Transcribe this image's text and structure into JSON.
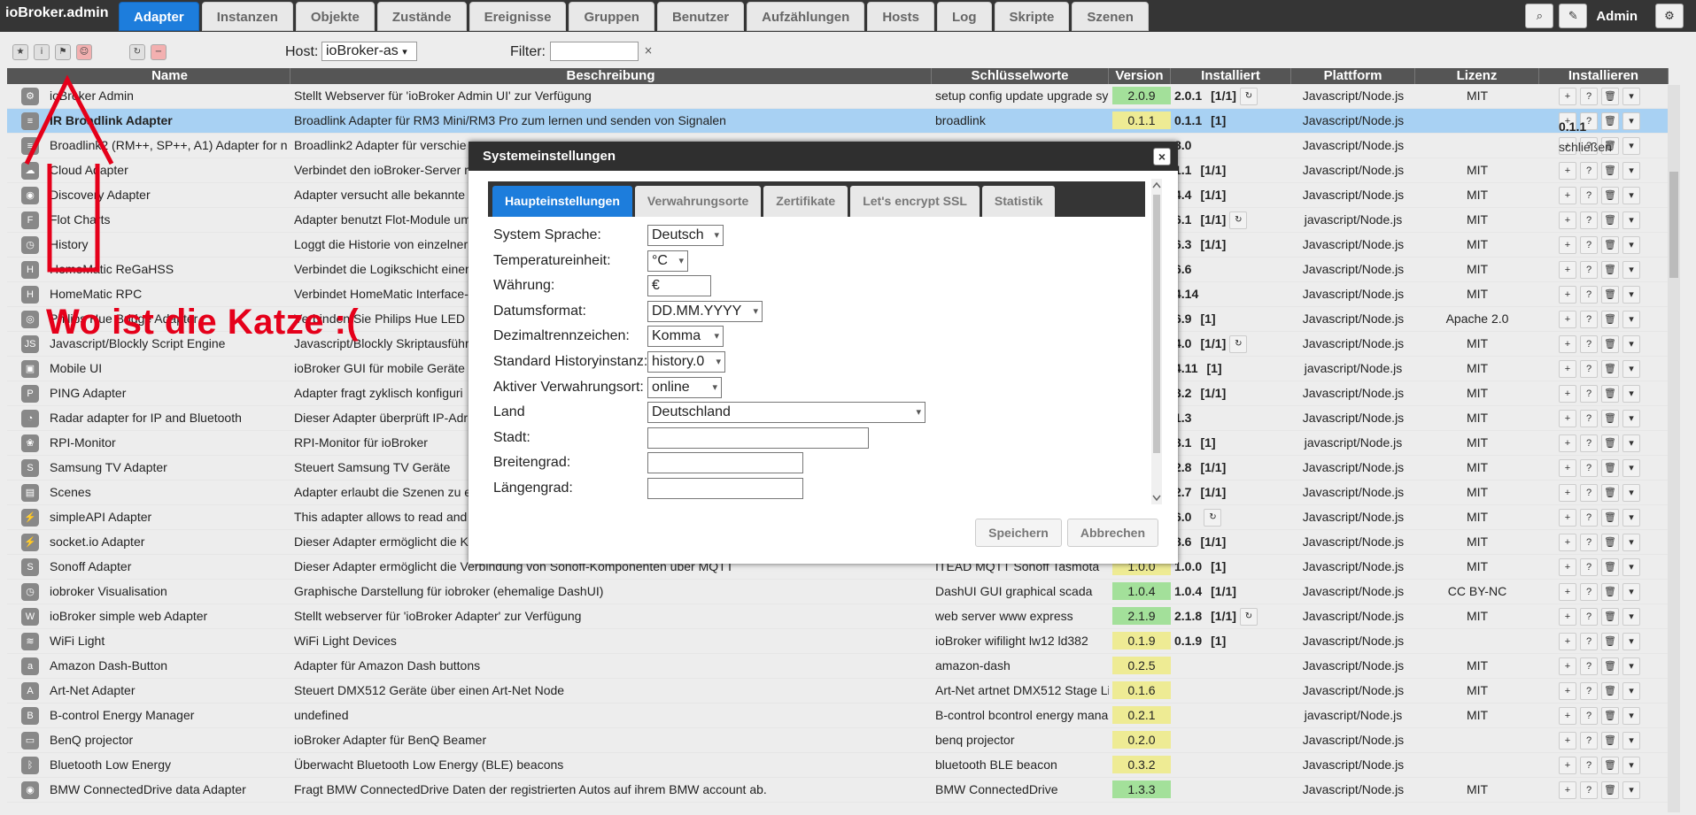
{
  "app": {
    "title": "ioBroker.admin",
    "user": "Admin"
  },
  "tabs": [
    "Adapter",
    "Instanzen",
    "Objekte",
    "Zustände",
    "Ereignisse",
    "Gruppen",
    "Benutzer",
    "Aufzählungen",
    "Hosts",
    "Log",
    "Skripte",
    "Szenen"
  ],
  "toolbar": {
    "host_label": "Host:",
    "host_value": "ioBroker-as",
    "filter_label": "Filter:",
    "filter_value": "",
    "filter_clear": "×"
  },
  "columns": [
    "Name",
    "Beschreibung",
    "Schlüsselworte",
    "Version",
    "Installiert",
    "Plattform",
    "Lizenz",
    "Installieren"
  ],
  "rows": [
    {
      "name": "ioBroker Admin",
      "desc": "Stellt Webserver für 'ioBroker Admin UI' zur Verfügung",
      "keys": "setup config update upgrade sy",
      "ver": "2.0.9",
      "vc": "green",
      "inst": "2.0.1",
      "cnt": "[1/1]",
      "plat": "Javascript/Node.js",
      "lic": "MIT",
      "icon": "⚙"
    },
    {
      "name": "IR Broadlink Adapter",
      "desc": "Broadlink Adapter für RM3 Mini/RM3 Pro zum lernen und senden von Signalen",
      "keys": "broadlink",
      "ver": "0.1.1",
      "vc": "yellow",
      "inst": "0.1.1",
      "cnt": "[1]",
      "plat": "Javascript/Node.js",
      "lic": "",
      "icon": "≡",
      "sel": true
    },
    {
      "name": "Broadlink2 (RM++, SP++, A1) Adapter for n",
      "desc": "Broadlink2 Adapter für verschie",
      "keys": "",
      "ver": "",
      "vc": "",
      "inst": "8.0",
      "cnt": "",
      "plat": "Javascript/Node.js",
      "lic": "",
      "icon": "≡"
    },
    {
      "name": "Cloud Adapter",
      "desc": "Verbindet den ioBroker-Server m",
      "keys": "",
      "ver": "",
      "vc": "",
      "inst": "1.1",
      "cnt": "[1/1]",
      "plat": "Javascript/Node.js",
      "lic": "MIT",
      "icon": "☁"
    },
    {
      "name": "Discovery Adapter",
      "desc": "Adapter versucht alle bekannte",
      "keys": "",
      "ver": "",
      "vc": "",
      "inst": "4.4",
      "cnt": "[1/1]",
      "plat": "Javascript/Node.js",
      "lic": "MIT",
      "icon": "◉"
    },
    {
      "name": "Flot Charts",
      "desc": "Adapter benutzt Flot-Module um",
      "keys": "",
      "ver": "",
      "vc": "",
      "inst": "6.1",
      "cnt": "[1/1]",
      "plat": "javascript/Node.js",
      "lic": "MIT",
      "icon": "F"
    },
    {
      "name": "History",
      "desc": "Loggt die Historie von einzelner",
      "keys": "",
      "ver": "",
      "vc": "",
      "inst": "6.3",
      "cnt": "[1/1]",
      "plat": "Javascript/Node.js",
      "lic": "MIT",
      "icon": "◷"
    },
    {
      "name": "HomeMatic ReGaHSS",
      "desc": "Verbindet die Logikschicht einer",
      "keys": "",
      "ver": "",
      "vc": "",
      "inst": "6.6",
      "cnt": "",
      "plat": "Javascript/Node.js",
      "lic": "MIT",
      "icon": "H"
    },
    {
      "name": "HomeMatic RPC",
      "desc": "Verbindet HomeMatic Interface-",
      "keys": "",
      "ver": "",
      "vc": "",
      "inst": "4.14",
      "cnt": "",
      "plat": "Javascript/Node.js",
      "lic": "MIT",
      "icon": "H"
    },
    {
      "name": "Philips Hue Bridge Adapter",
      "desc": "Verbinden Sie Philips Hue LED",
      "keys": "",
      "ver": "",
      "vc": "",
      "inst": "6.9",
      "cnt": "[1]",
      "plat": "Javascript/Node.js",
      "lic": "Apache 2.0",
      "icon": "◎"
    },
    {
      "name": "Javascript/Blockly Script Engine",
      "desc": "Javascript/Blockly Skriptausführ",
      "keys": "",
      "ver": "",
      "vc": "",
      "inst": "4.0",
      "cnt": "[1/1]",
      "plat": "Javascript/Node.js",
      "lic": "MIT",
      "icon": "JS"
    },
    {
      "name": "Mobile UI",
      "desc": "ioBroker GUI für mobile Geräte",
      "keys": "",
      "ver": "",
      "vc": "",
      "inst": "4.11",
      "cnt": "[1]",
      "plat": "javascript/Node.js",
      "lic": "MIT",
      "icon": "▣"
    },
    {
      "name": "PING Adapter",
      "desc": "Adapter fragt zyklisch konfiguri",
      "keys": "",
      "ver": "",
      "vc": "",
      "inst": "3.2",
      "cnt": "[1/1]",
      "plat": "Javascript/Node.js",
      "lic": "MIT",
      "icon": "P"
    },
    {
      "name": "Radar adapter for IP and Bluetooth",
      "desc": "Dieser Adapter überprüft IP-Adr",
      "keys": "",
      "ver": "",
      "vc": "",
      "inst": "1.3",
      "cnt": "",
      "plat": "Javascript/Node.js",
      "lic": "MIT",
      "icon": "◔"
    },
    {
      "name": "RPI-Monitor",
      "desc": "RPI-Monitor für ioBroker",
      "keys": "",
      "ver": "",
      "vc": "",
      "inst": "3.1",
      "cnt": "[1]",
      "plat": "javascript/Node.js",
      "lic": "MIT",
      "icon": "❀"
    },
    {
      "name": "Samsung TV Adapter",
      "desc": "Steuert Samsung TV Geräte",
      "keys": "",
      "ver": "",
      "vc": "",
      "inst": "2.8",
      "cnt": "[1/1]",
      "plat": "Javascript/Node.js",
      "lic": "MIT",
      "icon": "S"
    },
    {
      "name": "Scenes",
      "desc": "Adapter erlaubt die Szenen zu e",
      "keys": "",
      "ver": "",
      "vc": "",
      "inst": "2.7",
      "cnt": "[1/1]",
      "plat": "Javascript/Node.js",
      "lic": "MIT",
      "icon": "▤"
    },
    {
      "name": "simpleAPI Adapter",
      "desc": "This adapter allows to read and",
      "keys": "",
      "ver": "",
      "vc": "",
      "inst": "6.0",
      "cnt": "",
      "plat": "Javascript/Node.js",
      "lic": "MIT",
      "icon": "⚡"
    },
    {
      "name": "socket.io Adapter",
      "desc": "Dieser Adapter ermöglicht die K",
      "keys": "",
      "ver": "",
      "vc": "",
      "inst": "8.6",
      "cnt": "[1/1]",
      "plat": "Javascript/Node.js",
      "lic": "MIT",
      "icon": "⚡"
    },
    {
      "name": "Sonoff Adapter",
      "desc": "Dieser Adapter ermöglicht die Verbindung von Sonoff-Komponenten über MQTT",
      "keys": "ITEAD MQTT Sonoff Tasmota",
      "ver": "1.0.0",
      "vc": "yellow",
      "inst": "1.0.0",
      "cnt": "[1]",
      "plat": "Javascript/Node.js",
      "lic": "MIT",
      "icon": "S"
    },
    {
      "name": "iobroker Visualisation",
      "desc": "Graphische Darstellung für iobroker (ehemalige DashUI)",
      "keys": "DashUI GUI graphical scada",
      "ver": "1.0.4",
      "vc": "green",
      "inst": "1.0.4",
      "cnt": "[1/1]",
      "plat": "Javascript/Node.js",
      "lic": "CC BY-NC",
      "icon": "◷"
    },
    {
      "name": "ioBroker simple web Adapter",
      "desc": "Stellt webserver für 'ioBroker Adapter' zur Verfügung",
      "keys": "web server www express",
      "ver": "2.1.9",
      "vc": "green",
      "inst": "2.1.8",
      "cnt": "[1/1]",
      "plat": "Javascript/Node.js",
      "lic": "MIT",
      "icon": "W"
    },
    {
      "name": "WiFi Light",
      "desc": "WiFi Light Devices",
      "keys": "ioBroker wifilight lw12 ld382",
      "ver": "0.1.9",
      "vc": "yellow",
      "inst": "0.1.9",
      "cnt": "[1]",
      "plat": "Javascript/Node.js",
      "lic": "",
      "icon": "≋"
    },
    {
      "name": "Amazon Dash-Button",
      "desc": "Adapter für Amazon Dash buttons",
      "keys": "amazon-dash",
      "ver": "0.2.5",
      "vc": "yellow",
      "inst": "",
      "cnt": "",
      "plat": "Javascript/Node.js",
      "lic": "MIT",
      "icon": "a"
    },
    {
      "name": "Art-Net Adapter",
      "desc": "Steuert DMX512 Geräte über einen Art-Net Node",
      "keys": "Art-Net artnet DMX512 Stage Li",
      "ver": "0.1.6",
      "vc": "yellow",
      "inst": "",
      "cnt": "",
      "plat": "Javascript/Node.js",
      "lic": "MIT",
      "icon": "A"
    },
    {
      "name": "B-control Energy Manager",
      "desc": "undefined",
      "keys": "B-control bcontrol energy mana",
      "ver": "0.2.1",
      "vc": "yellow",
      "inst": "",
      "cnt": "",
      "plat": "javascript/Node.js",
      "lic": "MIT",
      "icon": "B"
    },
    {
      "name": "BenQ projector",
      "desc": "ioBroker Adapter für BenQ Beamer",
      "keys": "benq projector",
      "ver": "0.2.0",
      "vc": "yellow",
      "inst": "",
      "cnt": "",
      "plat": "Javascript/Node.js",
      "lic": "",
      "icon": "▭"
    },
    {
      "name": "Bluetooth Low Energy",
      "desc": "Überwacht Bluetooth Low Energy (BLE) beacons",
      "keys": "bluetooth BLE beacon",
      "ver": "0.3.2",
      "vc": "yellow",
      "inst": "",
      "cnt": "",
      "plat": "Javascript/Node.js",
      "lic": "",
      "icon": "ᛒ"
    },
    {
      "name": "BMW ConnectedDrive data Adapter",
      "desc": "Fragt BMW ConnectedDrive Daten der registrierten Autos auf ihrem BMW account ab.",
      "keys": "BMW ConnectedDrive",
      "ver": "1.3.3",
      "vc": "green",
      "inst": "",
      "cnt": "",
      "plat": "Javascript/Node.js",
      "lic": "MIT",
      "icon": "◉"
    }
  ],
  "row_popup": {
    "version": "0.1.1",
    "close_label": "schließen"
  },
  "annotation": "Wo ist die Katze :(",
  "dialog": {
    "title": "Systemeinstellungen",
    "close": "×",
    "tabs": [
      "Haupteinstellungen",
      "Verwahrungsorte",
      "Zertifikate",
      "Let's encrypt SSL",
      "Statistik"
    ],
    "fields": [
      {
        "label": "System Sprache:",
        "value": "Deutsch",
        "select": true
      },
      {
        "label": "Temperatureinheit:",
        "value": "°C",
        "select": true
      },
      {
        "label": "Währung:",
        "value": "€",
        "select": false
      },
      {
        "label": "Datumsformat:",
        "value": "DD.MM.YYYY",
        "select": true
      },
      {
        "label": "Dezimaltrennzeichen:",
        "value": "Komma",
        "select": true
      },
      {
        "label": "Standard Historyinstanz:",
        "value": "history.0",
        "select": true
      },
      {
        "label": "Aktiver Verwahrungsort:",
        "value": "online",
        "select": true
      },
      {
        "label": "Land",
        "value": "Deutschland",
        "select": true
      },
      {
        "label": "Stadt:",
        "value": "",
        "select": false
      },
      {
        "label": "Breitengrad:",
        "value": "",
        "select": false
      },
      {
        "label": "Längengrad:",
        "value": "",
        "select": false
      }
    ],
    "save_label": "Speichern",
    "cancel_label": "Abbrechen"
  }
}
